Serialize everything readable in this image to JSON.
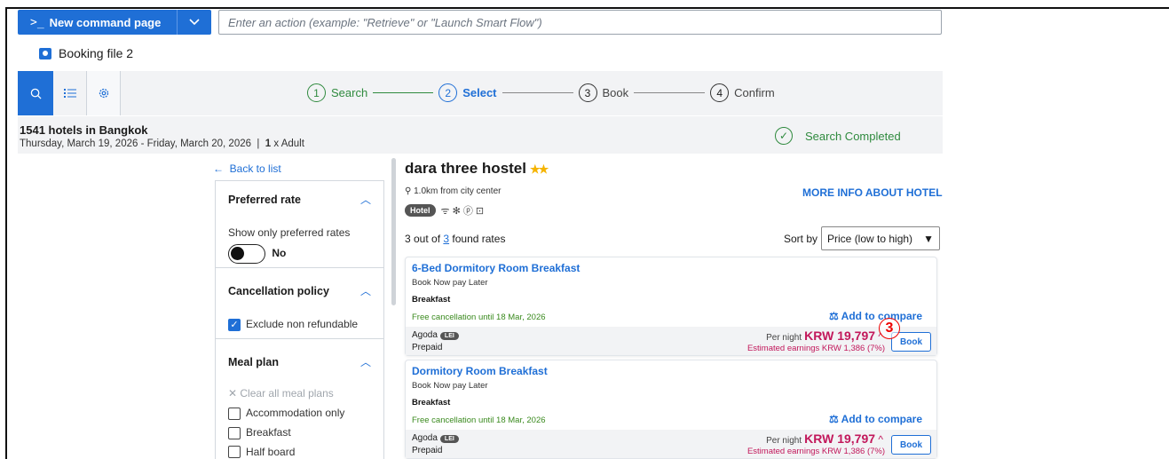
{
  "command": {
    "new_page_label": "New command page",
    "prompt_glyph": ">_",
    "input_placeholder": "Enter an action (example: \"Retrieve\" or \"Launch Smart Flow\")"
  },
  "booking_file": {
    "label": "Booking file 2"
  },
  "steps": [
    {
      "num": "1",
      "label": "Search"
    },
    {
      "num": "2",
      "label": "Select"
    },
    {
      "num": "3",
      "label": "Book"
    },
    {
      "num": "4",
      "label": "Confirm"
    }
  ],
  "summary": {
    "title": "1541 hotels in Bangkok",
    "dates": "Thursday, March 19, 2026 - Friday, March 20, 2026",
    "guests_count": "1",
    "guests_label": " x Adult",
    "status": "Search Completed"
  },
  "filters": {
    "back": "Back to list",
    "preferred": {
      "title": "Preferred rate",
      "text": "Show only preferred rates",
      "toggle": "No"
    },
    "cancellation": {
      "title": "Cancellation policy",
      "option": "Exclude non refundable"
    },
    "meal": {
      "title": "Meal plan",
      "clear": "Clear all meal plans",
      "options": [
        "Accommodation only",
        "Breakfast",
        "Half board"
      ]
    }
  },
  "hotel": {
    "name": "dara three hostel",
    "stars": "★★",
    "distance": "1.0km from city center",
    "more_info": "MORE INFO ABOUT HOTEL",
    "tag": "Hotel",
    "amenities": "ᯤ ✻ ⓟ ⊡",
    "found_prefix": "3 out of ",
    "found_count": "3",
    "found_suffix": " found rates",
    "sort_label": "Sort by",
    "sort_value": "Price (low to high)"
  },
  "rooms": [
    {
      "title": "6-Bed Dormitory Room Breakfast",
      "pay": "Book Now pay Later",
      "meal": "Breakfast",
      "cancel": "Free cancellation until 18 Mar, 2026",
      "compare": "Add to compare",
      "provider": "Agoda",
      "provider_tag": "LEI",
      "payment": "Prepaid",
      "per_night": "Per night",
      "price": "KRW 19,797",
      "earnings": "Estimated earnings KRW 1,386 (7%)",
      "book": "Book"
    },
    {
      "title": "Dormitory Room Breakfast",
      "pay": "Book Now pay Later",
      "meal": "Breakfast",
      "cancel": "Free cancellation until 18 Mar, 2026",
      "compare": "Add to compare",
      "provider": "Agoda",
      "provider_tag": "LEI",
      "payment": "Prepaid",
      "per_night": "Per night",
      "price": "KRW 19,797",
      "earnings": "Estimated earnings KRW 1,386 (7%)",
      "book": "Book"
    }
  ],
  "annotation": {
    "label": "3"
  }
}
